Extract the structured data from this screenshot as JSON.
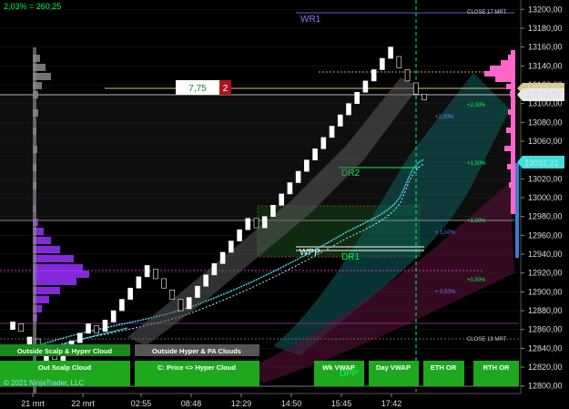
{
  "header": {
    "info_line": "2,03% = 260,25"
  },
  "colors": {
    "up_bar": "#ffffff",
    "down_bar": "#000000",
    "grid": "#202020",
    "green_line": "#00ff4c",
    "pink": "#ff66cc",
    "purple": "#9b30ff",
    "cyan": "#44d8e8",
    "teal_band": "#0f5f63",
    "magenta_band": "#5a0f3a"
  },
  "annotations": {
    "wr1": "WR1",
    "dr2": "DR2",
    "dr1": "DR1",
    "wpp": "WPP",
    "dpp": "DPP",
    "close_17": "CLOSE 17 MRT",
    "close_19": "CLOSE 19 MRT",
    "pct_200": "+2,00%",
    "pct_150": "+1,50%",
    "pct_100": "+1,00%",
    "pct_050": "+0,50%",
    "pct_100b": "+ 1,00%",
    "pct_050b": "+ 0,50%",
    "pct_212": "+2,00%"
  },
  "order": {
    "value": "7,75",
    "quantity": "2"
  },
  "price_markers": {
    "top": "13113,50",
    "current": "13104,75",
    "vwap": "13032,21"
  },
  "buttons": {
    "hyper_cloud": "Outside Scalp & Hyper Cloud",
    "hyper_pa": "Outside Hyper & PA Clouds",
    "scalp_cloud": "Out Scalp Cloud",
    "price_hyper": "C: Price <> Hyper Cloud",
    "wk_vwap": "Wk VWAP",
    "day_vwap": "Day VWAP",
    "eth_or": "ETH OR",
    "rth_or": "RTH OR"
  },
  "copyright": "© 2021 NinjaTrader, LLC",
  "chart_data": {
    "type": "bar",
    "instrument_info": "2,03% = 260,25",
    "yaxis": {
      "ticks": [
        13200,
        13180,
        13160,
        13140,
        13120,
        13100,
        13080,
        13060,
        13040,
        13020,
        13000,
        12980,
        12960,
        12940,
        12920,
        12900,
        12880,
        12860,
        12840,
        12820,
        12800
      ],
      "tick_labels": [
        "13200,00",
        "13180,00",
        "13160,00",
        "13140,00",
        "13120,00",
        "13100,00",
        "13080,00",
        "13060,00",
        "13040,00",
        "13020,00",
        "13000,00",
        "12980,00",
        "12960,00",
        "12940,00",
        "12920,00",
        "12900,00",
        "12880,00",
        "12860,00",
        "12840,00",
        "12820,00",
        "12800,00"
      ],
      "ylim": [
        12792,
        13210
      ]
    },
    "xaxis": {
      "tick_labels": [
        "21 mrt",
        "22 mrt",
        "02:55",
        "08:48",
        "12:29",
        "14:50",
        "15:45",
        "17:42"
      ]
    },
    "levels": {
      "close_17_mrt": 13200,
      "close_19_mrt": 12838,
      "wr1": 13190,
      "dr2": 13022,
      "dr1": 12934,
      "wpp": 12939,
      "current_price": 13104.75,
      "vwap_marker": 13032.21,
      "marker_top": 13113.5
    },
    "bars": [
      {
        "o": 12860,
        "c": 12868
      },
      {
        "o": 12866,
        "c": 12858
      },
      {
        "o": 12840,
        "c": 12852
      },
      {
        "o": 12850,
        "c": 12842
      },
      {
        "o": 12826,
        "c": 12838
      },
      {
        "o": 12836,
        "c": 12828
      },
      {
        "o": 12826,
        "c": 12836
      },
      {
        "o": 12838,
        "c": 12848
      },
      {
        "o": 12846,
        "c": 12856
      },
      {
        "o": 12856,
        "c": 12866
      },
      {
        "o": 12864,
        "c": 12856
      },
      {
        "o": 12858,
        "c": 12870
      },
      {
        "o": 12868,
        "c": 12880
      },
      {
        "o": 12880,
        "c": 12892
      },
      {
        "o": 12892,
        "c": 12904
      },
      {
        "o": 12904,
        "c": 12916
      },
      {
        "o": 12916,
        "c": 12928
      },
      {
        "o": 12924,
        "c": 12914
      },
      {
        "o": 12914,
        "c": 12904
      },
      {
        "o": 12902,
        "c": 12892
      },
      {
        "o": 12892,
        "c": 12880
      },
      {
        "o": 12882,
        "c": 12894
      },
      {
        "o": 12894,
        "c": 12906
      },
      {
        "o": 12906,
        "c": 12918
      },
      {
        "o": 12918,
        "c": 12930
      },
      {
        "o": 12930,
        "c": 12942
      },
      {
        "o": 12942,
        "c": 12954
      },
      {
        "o": 12954,
        "c": 12966
      },
      {
        "o": 12966,
        "c": 12978
      },
      {
        "o": 12978,
        "c": 12968
      },
      {
        "o": 12968,
        "c": 12980
      },
      {
        "o": 12980,
        "c": 12992
      },
      {
        "o": 12992,
        "c": 13004
      },
      {
        "o": 13004,
        "c": 13016
      },
      {
        "o": 13016,
        "c": 13028
      },
      {
        "o": 13028,
        "c": 13040
      },
      {
        "o": 13040,
        "c": 13052
      },
      {
        "o": 13052,
        "c": 13064
      },
      {
        "o": 13064,
        "c": 13076
      },
      {
        "o": 13076,
        "c": 13088
      },
      {
        "o": 13088,
        "c": 13100
      },
      {
        "o": 13100,
        "c": 13112
      },
      {
        "o": 13112,
        "c": 13124
      },
      {
        "o": 13124,
        "c": 13136
      },
      {
        "o": 13136,
        "c": 13148
      },
      {
        "o": 13148,
        "c": 13160
      },
      {
        "o": 13150,
        "c": 13138
      },
      {
        "o": 13136,
        "c": 13124
      },
      {
        "o": 13122,
        "c": 13110
      },
      {
        "o": 13110,
        "c": 13104
      }
    ]
  }
}
